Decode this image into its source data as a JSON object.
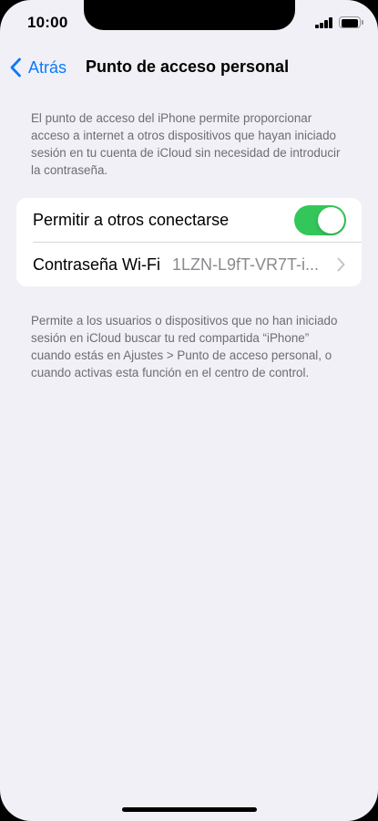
{
  "status_bar": {
    "time": "10:00"
  },
  "nav": {
    "back_label": "Atrás",
    "title": "Punto de acceso personal"
  },
  "description_top": "El punto de acceso del iPhone permite proporcionar acceso a internet a otros dispositivos que hayan iniciado sesión en tu cuenta de iCloud sin necesidad de introducir la contraseña.",
  "settings": {
    "allow_others": {
      "label": "Permitir a otros conectarse",
      "enabled": true
    },
    "wifi_password": {
      "label": "Contraseña Wi-Fi",
      "value": "1LZN-L9fT-VR7T-i..."
    }
  },
  "description_bottom": "Permite a los usuarios o dispositivos que no han iniciado sesión en iCloud buscar tu red compartida “iPhone” cuando estás en Ajustes > Punto de acceso personal, o cuando activas esta función en el centro de control.",
  "colors": {
    "accent": "#0a7aff",
    "toggle_on": "#33c759",
    "background": "#f0f0f6"
  },
  "icons": [
    "chevron-left-icon",
    "chevron-right-icon",
    "signal-icon",
    "battery-icon"
  ]
}
